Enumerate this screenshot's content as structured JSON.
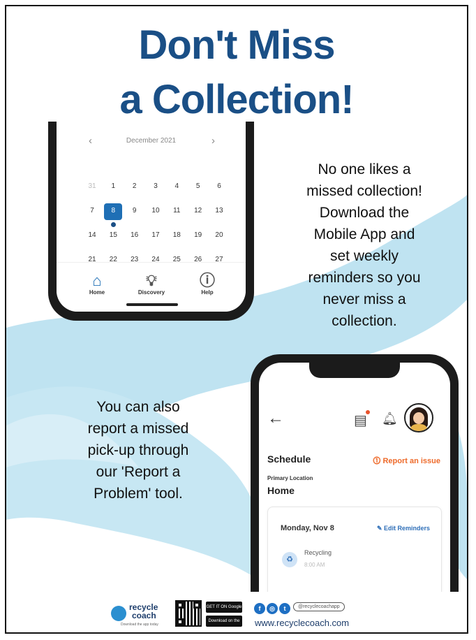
{
  "title": {
    "line1": "Don't Miss",
    "line2": "a Collection!"
  },
  "calendar": {
    "month": "December 2021",
    "prev": "‹",
    "next": "›",
    "rows": [
      [
        {
          "d": "31",
          "m": true
        },
        {
          "d": "1"
        },
        {
          "d": "2"
        },
        {
          "d": "3"
        },
        {
          "d": "4"
        },
        {
          "d": "5"
        },
        {
          "d": "6"
        }
      ],
      [
        {
          "d": "7"
        },
        {
          "d": "8",
          "sel": true
        },
        {
          "d": "9"
        },
        {
          "d": "10"
        },
        {
          "d": "11"
        },
        {
          "d": "12"
        },
        {
          "d": "13"
        }
      ],
      [
        {
          "d": "14"
        },
        {
          "d": "15"
        },
        {
          "d": "16"
        },
        {
          "d": "17"
        },
        {
          "d": "18"
        },
        {
          "d": "19"
        },
        {
          "d": "20"
        }
      ],
      [
        {
          "d": "21"
        },
        {
          "d": "22"
        },
        {
          "d": "23"
        },
        {
          "d": "24"
        },
        {
          "d": "25"
        },
        {
          "d": "26"
        },
        {
          "d": "27"
        }
      ]
    ]
  },
  "nav": {
    "home": "Home",
    "discovery": "Discovery",
    "help": "Help"
  },
  "blurb1": [
    "No one likes a",
    "missed collection!",
    "Download the",
    "Mobile App and",
    "set weekly",
    "reminders so you",
    "never miss a",
    "collection."
  ],
  "blurb2": [
    "You can also",
    "report a missed",
    "pick-up through",
    "our 'Report a",
    "Problem' tool."
  ],
  "app": {
    "schedule": "Schedule",
    "report": "⓵ Report an issue",
    "location_label": "Primary Location",
    "location": "Home",
    "date": "Monday, Nov 8",
    "edit": "✎ Edit Reminders",
    "item": "Recycling",
    "item_time": "8:00 AM"
  },
  "footer": {
    "brand1": "recycle",
    "brand2": "coach",
    "tagline": "Download the app today",
    "google": "GET IT ON Google Play",
    "apple": "Download on the App Store",
    "handle": "@recyclecoachapp",
    "site": "www.recyclecoach.com"
  },
  "colors": {
    "title": "#1a4f86",
    "swoosh": "#a9d7ea",
    "accent": "#1f6fb5",
    "report": "#ee6a2a"
  }
}
